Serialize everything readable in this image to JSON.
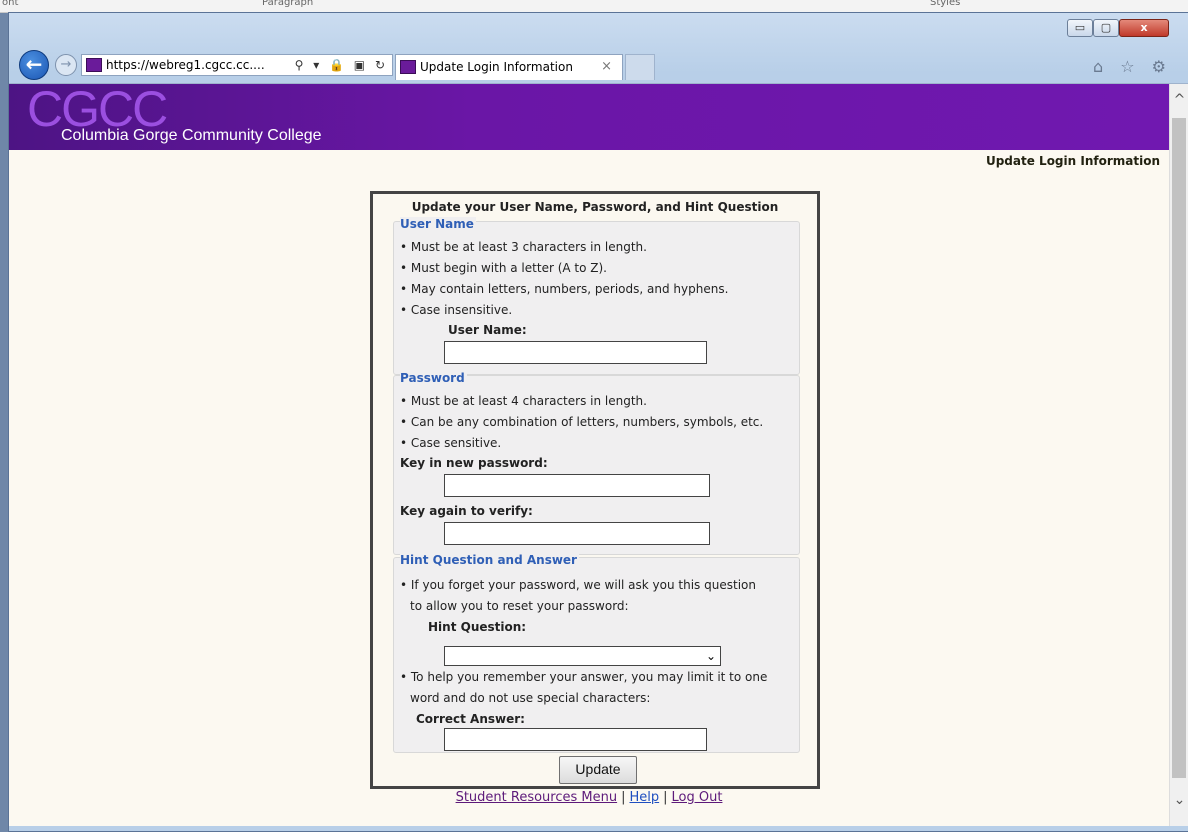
{
  "ribbon": {
    "left": "ont",
    "middle": "Paragraph",
    "right": "Styles"
  },
  "window": {
    "buttons": {
      "minimize": "▭",
      "maximize": "▢",
      "close": "x"
    }
  },
  "nav": {
    "back": "←",
    "forward": "→",
    "address_prefix": "https://",
    "address_host": "webreg1.cgcc.cc....",
    "address_icons": "⚲ ▾ 🔒 ▣ ↻",
    "tab_title": "Update Login Information",
    "tab_close": "×",
    "right_icons": "⌂ ☆ ⚙"
  },
  "banner": {
    "logo": "CGCC",
    "college_name": "Columbia Gorge Community College"
  },
  "page_heading": "Update Login Information",
  "form": {
    "title": "Update your User Name, Password, and Hint Question",
    "username_section": {
      "legend": "User Name",
      "rules": [
        "• Must be at least 3 characters in length.",
        "• Must begin with a letter (A to Z).",
        "• May contain letters, numbers, periods, and hyphens.",
        "• Case insensitive."
      ],
      "field_label": "User Name:",
      "value": ""
    },
    "password_section": {
      "legend": "Password",
      "rules": [
        "• Must be at least 4 characters in length.",
        "• Can be any combination of letters, numbers, symbols, etc.",
        "• Case sensitive."
      ],
      "new_label": "Key in new password:",
      "verify_label": "Key again to verify:"
    },
    "hint_section": {
      "legend": "Hint Question and Answer",
      "rule1_line1": "• If you forget your password, we will ask you this question",
      "rule1_line2": "to allow you to reset your password:",
      "question_label": "Hint Question:",
      "selected_question": "",
      "rule2_line1": "• To help you remember your answer, you may limit it to one",
      "rule2_line2": "word and do not use special characters:",
      "answer_label": "Correct Answer:"
    },
    "submit_label": "Update"
  },
  "footer": {
    "student_resources": "Student Resources Menu",
    "help": "Help",
    "logout": "Log Out",
    "separator": "|"
  },
  "scrollbar": {
    "up": "^",
    "down": "⌄"
  }
}
